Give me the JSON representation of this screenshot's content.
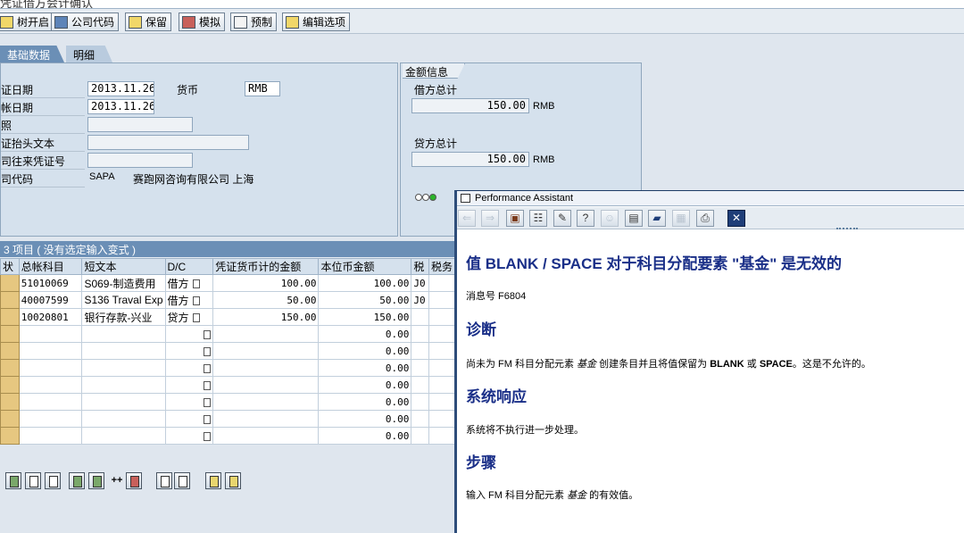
{
  "title": "凭证借方会计确认",
  "toolbar": {
    "tree_on": "树开启",
    "company_code": "公司代码",
    "hold": "保留",
    "simulate": "模拟",
    "park": "预制",
    "edit_options": "编辑选项"
  },
  "tabs": {
    "basic": "基础数据",
    "detail": "明细"
  },
  "form": {
    "doc_date_label": "证日期",
    "doc_date": "2013.11.26",
    "currency_label": "货币",
    "currency": "RMB",
    "post_date_label": "帐日期",
    "post_date": "2013.11.26",
    "ref_label": "照",
    "header_text_label": "证抬头文本",
    "cross_cc_label": "司往来凭证号",
    "company_label": "司代码",
    "company_code": "SAPA",
    "company_name": "赛跑网咨询有限公司 上海"
  },
  "amounts": {
    "legend": "金额信息",
    "debit_label": "借方总计",
    "debit_total": "150.00",
    "credit_label": "贷方总计",
    "credit_total": "150.00",
    "currency": "RMB"
  },
  "lights": [
    {
      "name": "light-red-icon",
      "color": "#ffffff"
    },
    {
      "name": "light-yellow-icon",
      "color": "#ffffff"
    },
    {
      "name": "light-green-icon",
      "color": "#2bb52b"
    }
  ],
  "items_table": {
    "title": "3 项目 ( 没有选定输入变式 )",
    "columns": [
      "状",
      "总帐科目",
      "短文本",
      "D/C",
      "凭证货币计的金额",
      "本位币金额",
      "税",
      "税务"
    ],
    "rows": [
      {
        "account": "51010069",
        "text": "S069-制造费用",
        "dc": "借方",
        "amount": "100.00",
        "local": "100.00",
        "tax": "J0"
      },
      {
        "account": "40007599",
        "text": "S136 Traval Exp",
        "dc": "借方",
        "amount": "50.00",
        "local": "50.00",
        "tax": "J0"
      },
      {
        "account": "10020801",
        "text": "银行存款-兴业",
        "dc": "贷方",
        "amount": "150.00",
        "local": "150.00",
        "tax": ""
      },
      {
        "account": "",
        "text": "",
        "dc": "",
        "amount": "",
        "local": "0.00",
        "tax": ""
      },
      {
        "account": "",
        "text": "",
        "dc": "",
        "amount": "",
        "local": "0.00",
        "tax": ""
      },
      {
        "account": "",
        "text": "",
        "dc": "",
        "amount": "",
        "local": "0.00",
        "tax": ""
      },
      {
        "account": "",
        "text": "",
        "dc": "",
        "amount": "",
        "local": "0.00",
        "tax": ""
      },
      {
        "account": "",
        "text": "",
        "dc": "",
        "amount": "",
        "local": "0.00",
        "tax": ""
      },
      {
        "account": "",
        "text": "",
        "dc": "",
        "amount": "",
        "local": "0.00",
        "tax": ""
      },
      {
        "account": "",
        "text": "",
        "dc": "",
        "amount": "",
        "local": "0.00",
        "tax": ""
      }
    ]
  },
  "bottom_toolbar": {
    "icons": [
      "detail-icon",
      "select-all-icon",
      "deselect-icon",
      "insert-row-icon",
      "add-row-icon",
      "add-lines-icon",
      "delete-row-icon",
      "copy-icon",
      "paste-icon",
      "sort-icon",
      "filter-icon"
    ],
    "plus_label": "++"
  },
  "perf_assistant": {
    "window_title": "Performance Assistant",
    "toolbar_icons": [
      "back-icon",
      "forward-icon",
      "book-icon",
      "technical-info-icon",
      "edit-icon",
      "help-icon",
      "person-icon",
      "layout-icon",
      "window-icon",
      "settings-icon",
      "print-icon",
      "close-icon"
    ],
    "heading": "值  BLANK / SPACE 对于科目分配要素  \"基金\" 是无效的",
    "message_no": "消息号  F6804",
    "diag_title": "诊断",
    "diag_text_1": "尚未为  FM 科目分配元素 ",
    "diag_element": "基金",
    "diag_text_2": " 创建条目并且将值保留为 ",
    "diag_blank": "BLANK",
    "diag_or": " 或  ",
    "diag_space": "SPACE",
    "diag_text_3": "。这是不允许的。",
    "resp_title": "系统响应",
    "resp_text": "系统将不执行进一步处理。",
    "steps_title": "步骤",
    "steps_text_1": "输入  FM 科目分配元素 ",
    "steps_element": "基金",
    "steps_text_2": " 的有效值。"
  }
}
